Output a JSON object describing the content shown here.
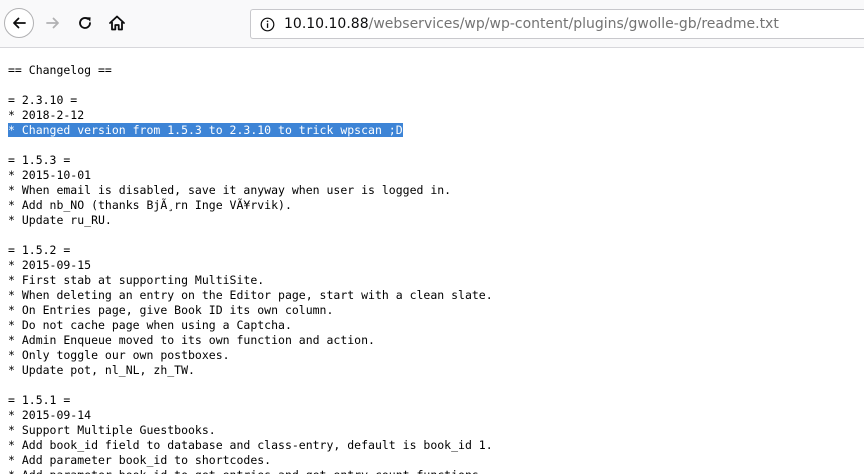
{
  "browser": {
    "nav": {
      "back_icon": "arrow-left-icon",
      "forward_icon": "arrow-right-icon",
      "reload_icon": "reload-icon",
      "home_icon": "home-icon"
    },
    "url": {
      "info_icon": "info-circle-icon",
      "host": "10.10.10.88",
      "path": "/webservices/wp/wp-content/plugins/gwolle-gb/readme.txt"
    }
  },
  "document": {
    "lines": [
      "== Changelog ==",
      "",
      "= 2.3.10 =",
      "* 2018-2-12",
      "* Changed version from 1.5.3 to 2.3.10 to trick wpscan ;D",
      "",
      "= 1.5.3 =",
      "* 2015-10-01",
      "* When email is disabled, save it anyway when user is logged in.",
      "* Add nb_NO (thanks BjÃ¸rn Inge VÃ¥rvik).",
      "* Update ru_RU.",
      "",
      "= 1.5.2 =",
      "* 2015-09-15",
      "* First stab at supporting MultiSite.",
      "* When deleting an entry on the Editor page, start with a clean slate.",
      "* On Entries page, give Book ID its own column.",
      "* Do not cache page when using a Captcha.",
      "* Admin Enqueue moved to its own function and action.",
      "* Only toggle our own postboxes.",
      "* Update pot, nl_NL, zh_TW.",
      "",
      "= 1.5.1 =",
      "* 2015-09-14",
      "* Support Multiple Guestbooks.",
      "* Add book_id field to database and class-entry, default is book_id 1.",
      "* Add parameter book_id to shortcodes.",
      "* Add parameter book_id to get_entries and get_entry_count functions."
    ],
    "selected_line_index": 4,
    "selection_color": "#3d84d6"
  }
}
